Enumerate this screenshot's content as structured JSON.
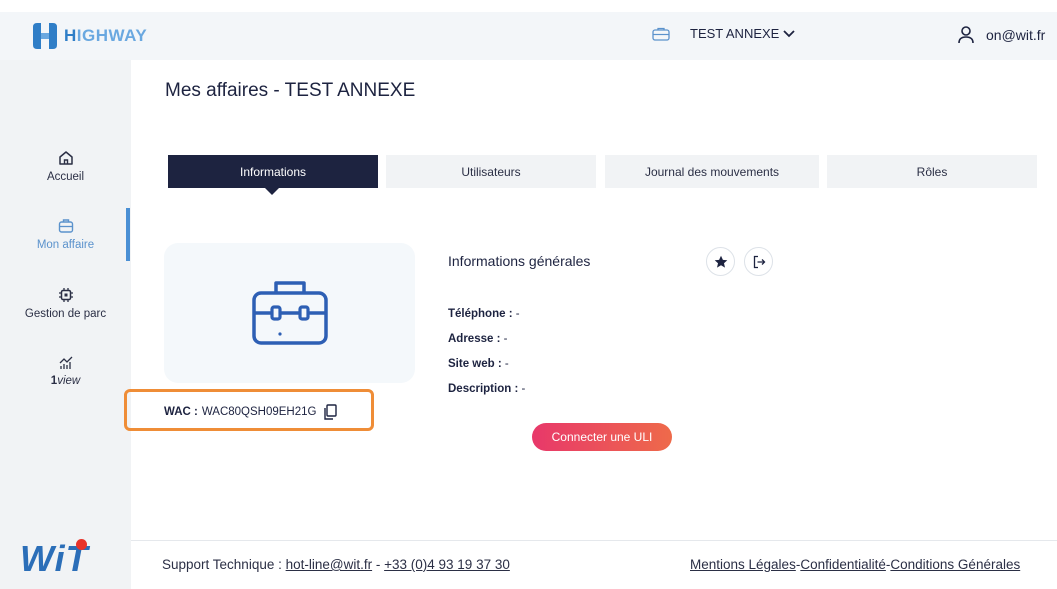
{
  "header": {
    "logo_text_h": "H",
    "logo_text_rest": "IGHWAY",
    "affaire_name": "TEST ANNEXE",
    "user_email": "on@wit.fr"
  },
  "sidebar": {
    "items": [
      {
        "label": "Accueil",
        "icon": "home-icon"
      },
      {
        "label": "Mon affaire",
        "icon": "briefcase-icon"
      },
      {
        "label": "Gestion de parc",
        "icon": "chip-icon"
      },
      {
        "label_bold": "1",
        "label_italic": "view",
        "icon": "chart-icon"
      }
    ],
    "active_index": 1,
    "footer_logo": "WiT"
  },
  "main": {
    "title": "Mes affaires - TEST ANNEXE",
    "tabs": [
      {
        "label": "Informations"
      },
      {
        "label": "Utilisateurs"
      },
      {
        "label": "Journal des mouvements"
      },
      {
        "label": "Rôles"
      }
    ],
    "active_tab": 0,
    "info": {
      "title": "Informations générales",
      "fields": [
        {
          "label": "Téléphone :",
          "value": "-"
        },
        {
          "label": "Adresse :",
          "value": "-"
        },
        {
          "label": "Site web :",
          "value": "-"
        },
        {
          "label": "Description :",
          "value": "-"
        }
      ]
    },
    "wac": {
      "label": "WAC :",
      "value": "WAC80QSH09EH21G"
    },
    "connect_button": "Connecter une ULI"
  },
  "footer": {
    "support_label": "Support Technique :",
    "support_email": "hot-line@wit.fr",
    "separator": "-",
    "phone": "+33 (0)4 93 19 37 30",
    "links": [
      "Mentions Légales",
      "Confidentialité",
      "Conditions Générales"
    ],
    "link_sep": "-"
  },
  "colors": {
    "navy": "#1d2340",
    "accent": "#4a8fd4",
    "highlight": "#ef8d37",
    "button_start": "#e8386a",
    "button_end": "#ee6a4a"
  }
}
